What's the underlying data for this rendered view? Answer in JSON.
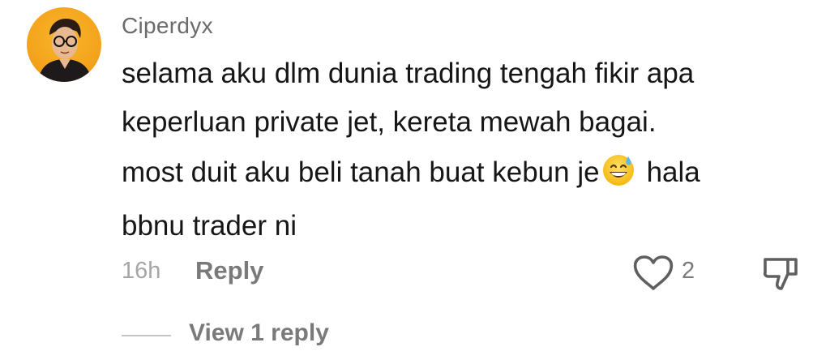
{
  "comment": {
    "username": "Ciperdyx",
    "text_lines_1": [
      "selama aku dlm dunia trading tengah fikir apa",
      "keperluan private jet, kereta mewah bagai."
    ],
    "text_line_3_before_emoji": "most duit aku beli tanah buat kebun je",
    "text_line_3_after_emoji": "hala",
    "text_line_4": "bbnu trader ni",
    "emoji": "grinning-face-with-sweat",
    "timestamp": "16h",
    "reply_label": "Reply",
    "like_count": "2",
    "view_replies_label": "View 1 reply"
  },
  "icons": {
    "like": "heart-outline-icon",
    "dislike": "thumbs-down-outline-icon"
  },
  "colors": {
    "username": "#6b6b6b",
    "text": "#161616",
    "muted": "#a6a6a6",
    "action": "#7a7a7a",
    "avatar_bg": "#f4a41c"
  }
}
